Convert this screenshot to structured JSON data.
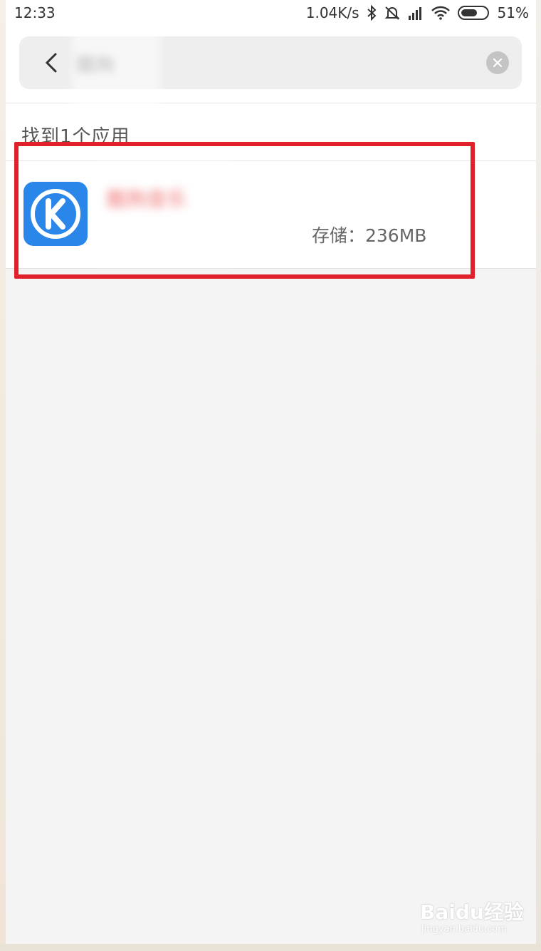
{
  "status_bar": {
    "time": "12:33",
    "net_speed": "1.04K/s",
    "battery": "51%",
    "icons": [
      "bluetooth-icon",
      "mute-icon",
      "signal-icon",
      "wifi-icon",
      "battery-icon"
    ]
  },
  "search": {
    "query": "酷狗"
  },
  "results": {
    "title": "找到1个应用",
    "items": [
      {
        "name": "酷狗音乐",
        "subtitle": "",
        "storage": "存储：236MB",
        "icon": "kugou-k-icon",
        "icon_color": "#2a86e8"
      }
    ]
  },
  "highlight": {
    "color": "#e0202a"
  },
  "watermark": {
    "main": "Baidu经验",
    "sub": "jingyan.baidu.com"
  }
}
